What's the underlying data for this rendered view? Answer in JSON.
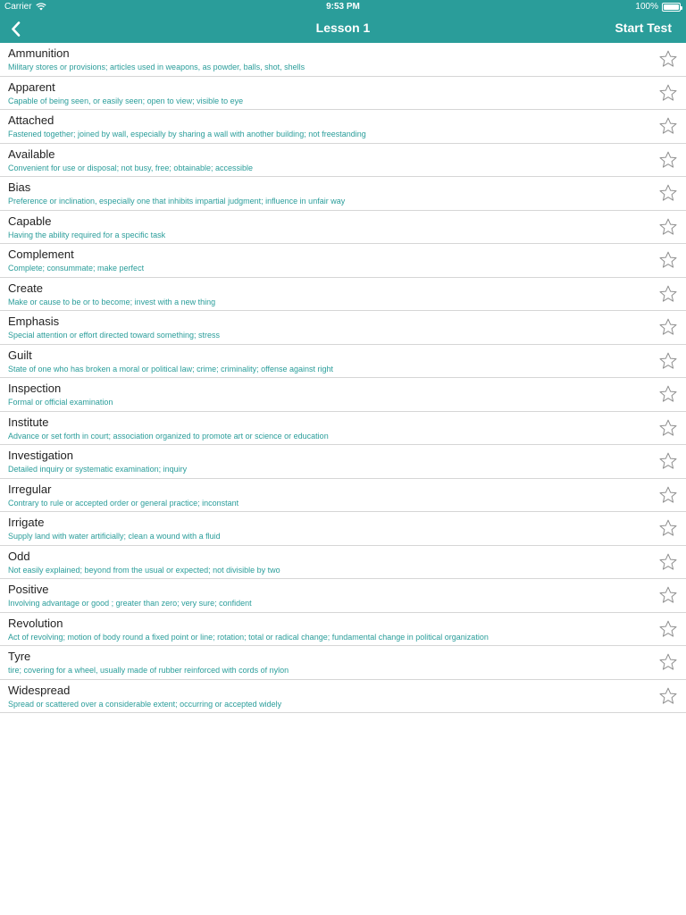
{
  "status_bar": {
    "carrier": "Carrier",
    "time": "9:53 PM",
    "battery": "100%",
    "battery_level": 1.0
  },
  "nav": {
    "back_icon": "chevron-left-icon",
    "title": "Lesson 1",
    "action": "Start Test"
  },
  "colors": {
    "accent": "#2a9d9a",
    "text": "#222222",
    "divider": "#d6d6d6",
    "star_outline": "#8e8e8e"
  },
  "words": [
    {
      "word": "Ammunition",
      "definition": "Military stores or provisions; articles used in weapons, as powder, balls, shot, shells"
    },
    {
      "word": "Apparent",
      "definition": "Capable of being seen, or easily seen; open to view; visible to eye"
    },
    {
      "word": "Attached",
      "definition": "Fastened together; joined by wall, especially by sharing a wall with another building; not freestanding"
    },
    {
      "word": "Available",
      "definition": "Convenient for use or disposal; not busy, free; obtainable; accessible"
    },
    {
      "word": "Bias",
      "definition": "Preference or inclination, especially one that inhibits impartial judgment; influence in unfair way"
    },
    {
      "word": "Capable",
      "definition": "Having the ability required for a specific task"
    },
    {
      "word": "Complement",
      "definition": "Complete; consummate; make perfect"
    },
    {
      "word": "Create",
      "definition": "Make or cause to be or to become; invest with a new thing"
    },
    {
      "word": "Emphasis",
      "definition": "Special attention or effort directed toward something; stress"
    },
    {
      "word": "Guilt",
      "definition": "State of one who has broken a moral or political law; crime; criminality; offense against right"
    },
    {
      "word": "Inspection",
      "definition": "Formal or official examination"
    },
    {
      "word": "Institute",
      "definition": "Advance or set forth in court; association organized to promote art or science or education"
    },
    {
      "word": "Investigation",
      "definition": "Detailed inquiry or systematic examination; inquiry"
    },
    {
      "word": "Irregular",
      "definition": "Contrary to rule or accepted order or general practice; inconstant"
    },
    {
      "word": "Irrigate",
      "definition": "Supply land with water artificially; clean a wound with a fluid"
    },
    {
      "word": "Odd",
      "definition": "Not easily explained; beyond from the usual or expected; not divisible by two"
    },
    {
      "word": "Positive",
      "definition": "Involving advantage or good ; greater than zero; very sure; confident"
    },
    {
      "word": "Revolution",
      "definition": "Act of revolving; motion of body round a fixed point or line; rotation; total or radical change; fundamental change in political organization"
    },
    {
      "word": "Tyre",
      "definition": " tire; covering for a wheel, usually made of rubber reinforced with cords of nylon"
    },
    {
      "word": "Widespread",
      "definition": "Spread or scattered over a considerable extent; occurring or accepted widely"
    }
  ]
}
